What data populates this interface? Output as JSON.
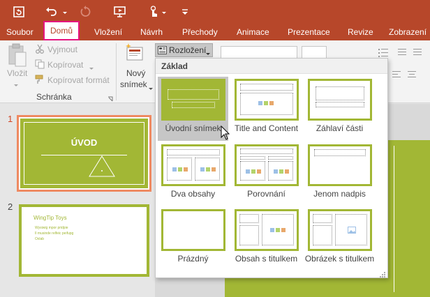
{
  "qat": {
    "buttons": [
      "save-icon",
      "undo-icon",
      "redo-icon",
      "present-icon",
      "touch-mode-icon",
      "customize-icon"
    ]
  },
  "tabs": [
    {
      "label": "Soubor",
      "active": false
    },
    {
      "label": "Domů",
      "active": true
    },
    {
      "label": "Vložení",
      "active": false
    },
    {
      "label": "Návrh",
      "active": false
    },
    {
      "label": "Přechody",
      "active": false
    },
    {
      "label": "Animace",
      "active": false
    },
    {
      "label": "Prezentace",
      "active": false
    },
    {
      "label": "Revize",
      "active": false
    },
    {
      "label": "Zobrazení",
      "active": false
    }
  ],
  "ribbon": {
    "paste_label": "Vložit",
    "cut_label": "Vyjmout",
    "copy_label": "Kopírovat",
    "format_painter_label": "Kopírovat formát",
    "clipboard_group": "Schránka",
    "new_slide_line1": "Nový",
    "new_slide_line2": "snímek",
    "layout_button": "Rozložení"
  },
  "gallery": {
    "header": "Základ",
    "layouts": [
      {
        "label": "Úvodní snímek",
        "selected": true
      },
      {
        "label": "Title and Content",
        "selected": false
      },
      {
        "label": "Záhlaví části",
        "selected": false
      },
      {
        "label": "Dva obsahy",
        "selected": false
      },
      {
        "label": "Porovnání",
        "selected": false
      },
      {
        "label": "Jenom nadpis",
        "selected": false
      },
      {
        "label": "Prázdný",
        "selected": false
      },
      {
        "label": "Obsah s titulkem",
        "selected": false
      },
      {
        "label": "Obrázek s titulkem",
        "selected": false
      }
    ]
  },
  "slides": [
    {
      "number": "1",
      "title": "ÚVOD",
      "selected": true
    },
    {
      "number": "2",
      "title": "WingTip Toys",
      "bullets": [
        "Wysiwig mpor pridpie",
        "Il musinde relfeic peifupg",
        "Oxlab"
      ],
      "selected": false
    }
  ],
  "colors": {
    "accent": "#b7472a",
    "theme_green": "#a2b735",
    "active_tab_border": "#e7157f",
    "selected_slide_border": "#ef8a62"
  }
}
